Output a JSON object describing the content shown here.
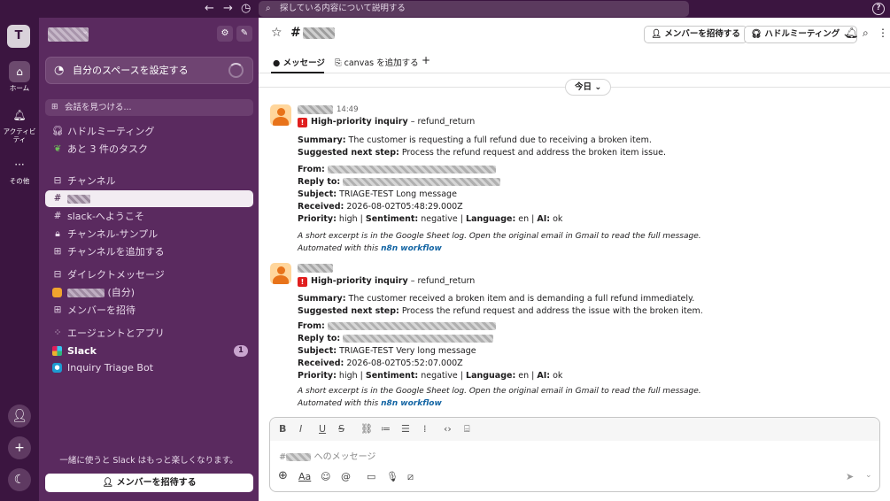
{
  "topbar": {
    "search_placeholder": "探している内容について説明する",
    "help": "?"
  },
  "rail": {
    "workspace_initial": "T",
    "items": [
      {
        "label": "ホーム",
        "icon": "home-icon"
      },
      {
        "label": "アクティビティ",
        "icon": "bell-icon"
      },
      {
        "label": "その他",
        "icon": "more-dots-icon"
      }
    ]
  },
  "sidebar": {
    "promo": "自分のスペースを設定する",
    "find": "会話を見つける...",
    "huddle": "ハドルミーティング",
    "tasks": "あと 3 件のタスク",
    "channels_header": "チャンネル",
    "channels": [
      {
        "prefix": "#",
        "label": ""
      },
      {
        "prefix": "#",
        "label": "slack-へようこそ"
      },
      {
        "prefix": "🔒",
        "label": "チャンネル-サンプル"
      }
    ],
    "add_channel": "チャンネルを追加する",
    "dm_header": "ダイレクトメッセージ",
    "dm_self_suffix": "(自分)",
    "invite_members": "メンバーを招待",
    "apps_header": "エージェントとアプリ",
    "apps": [
      {
        "label": "Slack",
        "badge": "1"
      },
      {
        "label": "Inquiry Triage Bot",
        "badge": ""
      }
    ],
    "footer_text": "一緒に使うと Slack はもっと楽しくなります。",
    "footer_button": "メンバーを招待する"
  },
  "header": {
    "channel_prefix": "#",
    "invite_button": "メンバーを招待する",
    "huddle_button": "ハドルミーティング"
  },
  "tabs": {
    "messages": "メッセージ",
    "add_canvas": "canvas を追加する",
    "add": "+"
  },
  "date_divider": "今日",
  "messages": [
    {
      "time": "14:49",
      "title_bold": "High-priority inquiry",
      "title_rest": " – refund_return",
      "summary_label": "Summary:",
      "summary": " The customer is requesting a full refund due to receiving a broken item.",
      "next_label": "Suggested next step:",
      "next": " Process the refund request and address the broken item issue.",
      "from_label": "From:",
      "reply_label": "Reply to:",
      "subject_label": "Subject:",
      "subject": " TRIAGE-TEST Long message",
      "received_label": "Received:",
      "received": " 2026-08-02T05:48:29.000Z",
      "priority_label": "Priority:",
      "priority": " high",
      "sentiment_label": "Sentiment:",
      "sentiment": " negative",
      "language_label": "Language:",
      "language": " en",
      "ai_label": "AI:",
      "ai": " ok",
      "excerpt": "A short excerpt is in the Google Sheet log. Open the original email in Gmail to read the full message.",
      "automated": "Automated with this ",
      "link": "n8n workflow"
    },
    {
      "title_bold": "High-priority inquiry",
      "title_rest": " – refund_return",
      "summary_label": "Summary:",
      "summary": " The customer received a broken item and is demanding a full refund immediately.",
      "next_label": "Suggested next step:",
      "next": " Process the refund request and address the issue with the broken item.",
      "from_label": "From:",
      "reply_label": "Reply to:",
      "subject_label": "Subject:",
      "subject": " TRIAGE-TEST Very long message",
      "received_label": "Received:",
      "received": " 2026-08-02T05:52:07.000Z",
      "priority_label": "Priority:",
      "priority": " high",
      "sentiment_label": "Sentiment:",
      "sentiment": " negative",
      "language_label": "Language:",
      "language": " en",
      "ai_label": "AI:",
      "ai": " ok",
      "excerpt": "A short excerpt is in the Google Sheet log. Open the original email in Gmail to read the full message.",
      "automated": "Automated with this ",
      "link": "n8n workflow"
    }
  ],
  "composer": {
    "prefix": "#",
    "placeholder_suffix": " へのメッセージ"
  },
  "colors": {
    "sidebar": "#5a2a5f",
    "rail": "#3b1540",
    "link": "#1264a3",
    "badge": "#c9a5cf"
  }
}
